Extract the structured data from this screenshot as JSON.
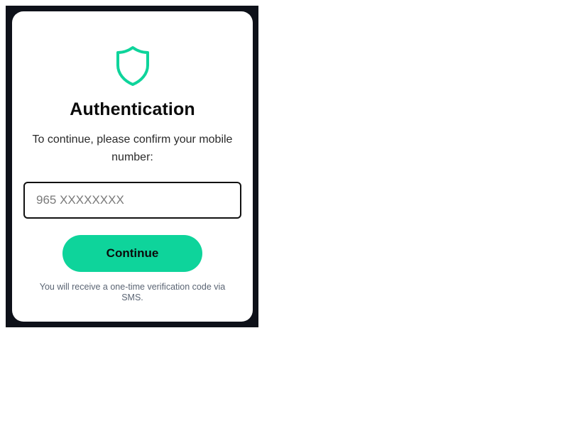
{
  "auth": {
    "title": "Authentication",
    "subtitle": "To continue, please confirm your mobile number:",
    "phone_placeholder": "965 XXXXXXXX",
    "phone_value": "",
    "continue_label": "Continue",
    "sms_note": "You will receive a one-time verification code via SMS.",
    "icon": "shield-icon"
  },
  "colors": {
    "accent": "#0ed49b",
    "frame_background": "#0e1119",
    "card_background": "#ffffff",
    "title_text": "#0b0b0b",
    "note_text": "#5b6574"
  }
}
